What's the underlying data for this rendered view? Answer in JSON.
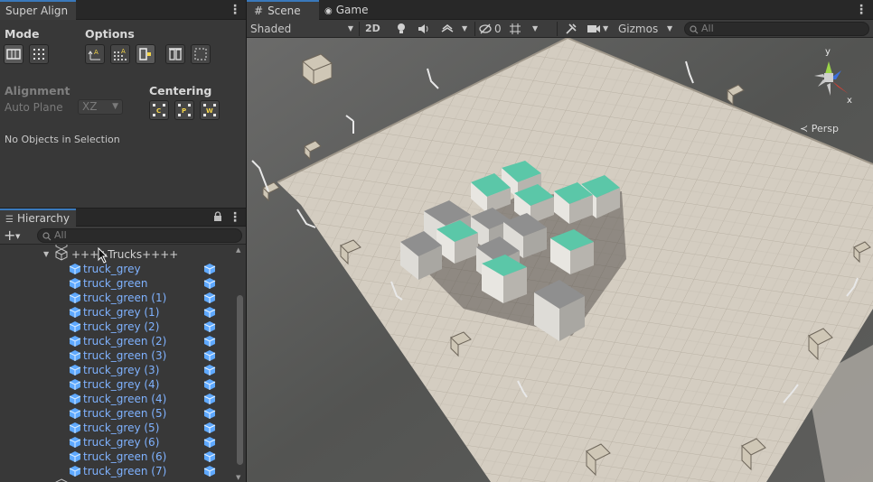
{
  "super_align": {
    "tab_label": "Super Align",
    "mode_title": "Mode",
    "options_title": "Options",
    "alignment_title": "Alignment",
    "auto_plane_label": "Auto Plane",
    "auto_plane_value": "XZ",
    "centering_title": "Centering",
    "status_text": "No Objects in Selection",
    "centering_buttons": [
      "C",
      "P",
      "W"
    ]
  },
  "hierarchy": {
    "tab_label": "Hierarchy",
    "search_placeholder": "All",
    "parent_label": "++++Trucks++++",
    "items": [
      {
        "label": "truck_grey"
      },
      {
        "label": "truck_green"
      },
      {
        "label": "truck_green (1)"
      },
      {
        "label": "truck_grey (1)"
      },
      {
        "label": "truck_grey (2)"
      },
      {
        "label": "truck_green (2)"
      },
      {
        "label": "truck_green (3)"
      },
      {
        "label": "truck_grey (3)"
      },
      {
        "label": "truck_grey (4)"
      },
      {
        "label": "truck_green (4)"
      },
      {
        "label": "truck_green (5)"
      },
      {
        "label": "truck_grey (5)"
      },
      {
        "label": "truck_grey (6)"
      },
      {
        "label": "truck_green (6)"
      },
      {
        "label": "truck_green (7)"
      }
    ]
  },
  "scene": {
    "tabs": [
      {
        "label": "Scene"
      },
      {
        "label": "Game"
      }
    ],
    "shading_mode": "Shaded",
    "toggle_2d": "2D",
    "hidden_count": "0",
    "gizmos_label": "Gizmos",
    "search_placeholder": "All",
    "persp_label": "Persp",
    "gizmo_axes": {
      "y": "y",
      "x": "x"
    }
  },
  "colors": {
    "link_blue": "#7fb2ff",
    "tab_accent": "#3a79bb",
    "truck_green_top": "#5bc7a8",
    "ground_tile": "#cfc8bc"
  }
}
